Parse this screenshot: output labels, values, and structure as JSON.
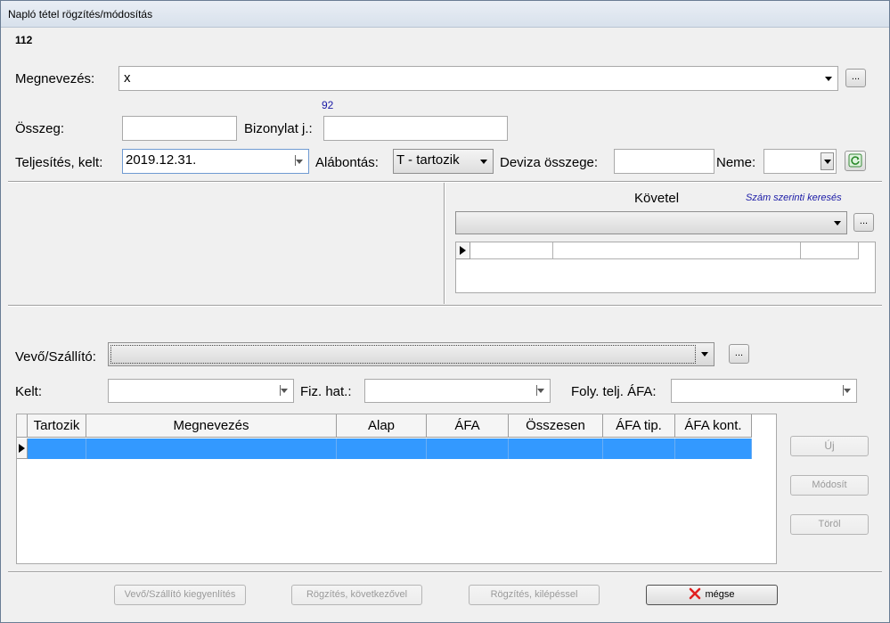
{
  "window": {
    "title": "Napló tétel rögzítés/módosítás"
  },
  "record_id": "112",
  "megnevezes": {
    "label": "Megnevezés:",
    "value": "x",
    "browse_label": "..."
  },
  "doc_counter": "92",
  "osszeg": {
    "label": "Összeg:",
    "value": ""
  },
  "bizonylat": {
    "label": "Bizonylat j.:",
    "value": ""
  },
  "teljesites": {
    "label": "Teljesítés, kelt:",
    "value": "2019.12.31."
  },
  "alabontas": {
    "label": "Alábontás:",
    "value": "T - tartozik"
  },
  "deviza": {
    "label": "Deviza összege:",
    "value": ""
  },
  "neme": {
    "label": "Neme:",
    "value": ""
  },
  "kovetel": {
    "title": "Követel",
    "search_link": "Szám szerinti keresés",
    "browse_label": "..."
  },
  "vevo": {
    "label": "Vevő/Szállító:",
    "value": "",
    "browse_label": "..."
  },
  "kelt": {
    "label": "Kelt:",
    "value": ""
  },
  "fizhat": {
    "label": "Fiz. hat.:",
    "value": ""
  },
  "folyafa": {
    "label": "Foly. telj. ÁFA:",
    "value": ""
  },
  "grid": {
    "columns": [
      "Tartozik",
      "Megnevezés",
      "Alap",
      "ÁFA",
      "Összesen",
      "ÁFA tip.",
      "ÁFA kont."
    ]
  },
  "side_buttons": {
    "new": "Új",
    "modify": "Módosít",
    "delete": "Töröl"
  },
  "footer": {
    "balance": "Vevő/Szállító kiegyenlítés",
    "save_next": "Rögzítés, következővel",
    "save_exit": "Rögzítés, kilépéssel",
    "cancel": "mégse"
  },
  "colors": {
    "selection": "#3399ff",
    "link": "#1a1aa6",
    "cancel_x": "#e02020"
  }
}
